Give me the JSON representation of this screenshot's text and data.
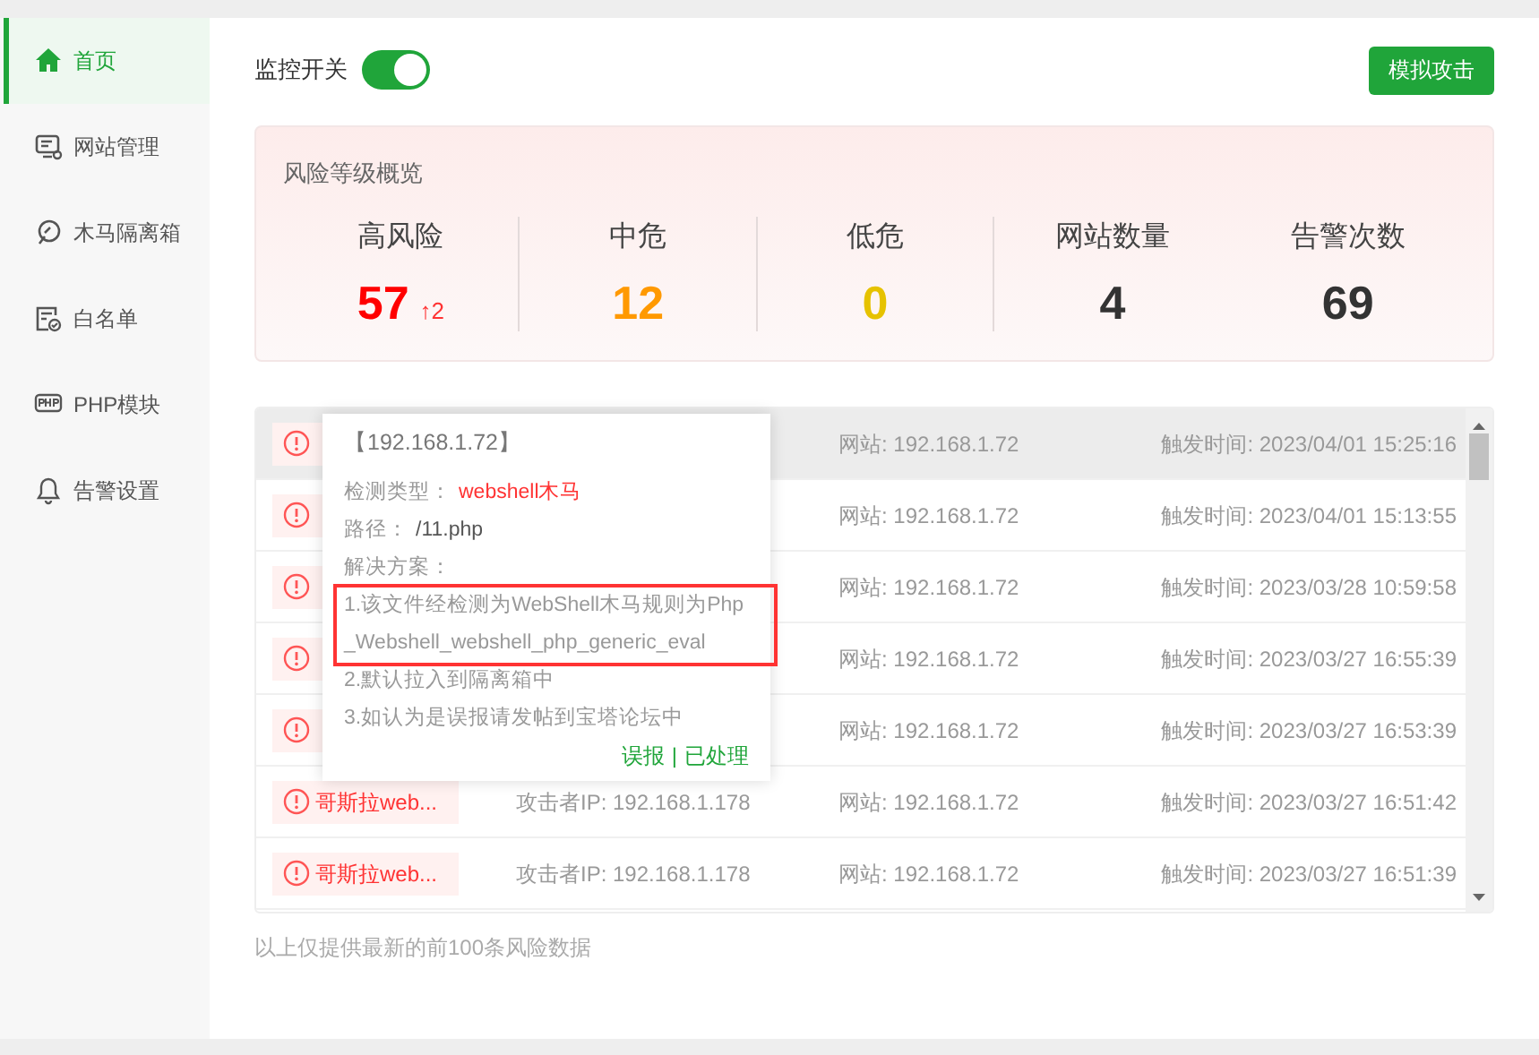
{
  "sidebar": {
    "items": [
      {
        "kind": "home",
        "label": "首页",
        "selected": true
      },
      {
        "kind": "site",
        "label": "网站管理",
        "selected": false
      },
      {
        "kind": "trojan",
        "label": "木马隔离箱",
        "selected": false
      },
      {
        "kind": "whitelist",
        "label": "白名单",
        "selected": false
      },
      {
        "kind": "php",
        "label": "PHP模块",
        "selected": false
      },
      {
        "kind": "bell",
        "label": "告警设置",
        "selected": false
      }
    ]
  },
  "monitor": {
    "label": "监控开关",
    "on": true
  },
  "simulate_button": "模拟攻击",
  "overview": {
    "title": "风险等级概览",
    "stats": [
      {
        "label": "高风险",
        "value": "57",
        "color": "#ff0000",
        "delta": "↑2"
      },
      {
        "label": "中危",
        "value": "12",
        "color": "#ff9900"
      },
      {
        "label": "低危",
        "value": "0",
        "color": "#e6c200"
      },
      {
        "label": "网站数量",
        "value": "4",
        "color": "#333333"
      },
      {
        "label": "告警次数",
        "value": "69",
        "color": "#333333"
      }
    ]
  },
  "events": [
    {
      "site": "网站: 192.168.1.72",
      "time": "触发时间: 2023/04/01 15:25:16",
      "hovered": true
    },
    {
      "site": "网站: 192.168.1.72",
      "time": "触发时间: 2023/04/01 15:13:55",
      "hovered": false
    },
    {
      "site": "网站: 192.168.1.72",
      "time": "触发时间: 2023/03/28 10:59:58",
      "hovered": false
    },
    {
      "site": "网站: 192.168.1.72",
      "time": "触发时间: 2023/03/27 16:55:39",
      "hovered": false
    },
    {
      "site": "网站: 192.168.1.72",
      "time": "触发时间: 2023/03/27 16:53:39",
      "hovered": false
    },
    {
      "tag": "哥斯拉web...",
      "attacker": "攻击者IP: 192.168.1.178",
      "site": "网站: 192.168.1.72",
      "time": "触发时间: 2023/03/27 16:51:42",
      "hovered": false
    },
    {
      "tag": "哥斯拉web...",
      "attacker": "攻击者IP: 192.168.1.178",
      "site": "网站: 192.168.1.72",
      "time": "触发时间: 2023/03/27 16:51:39",
      "hovered": false
    }
  ],
  "popup": {
    "title": "【192.168.1.72】",
    "type_label": "检测类型：",
    "type_value": "webshell木马",
    "path_label": "路径：",
    "path_value": "/11.php",
    "solution_label": "解决方案：",
    "steps": [
      {
        "text": "1.该文件经检测为WebShell木马规则为Php_Webshell_webshell_php_generic_eval",
        "highlighted": true
      },
      {
        "text": "2.默认拉入到隔离箱中",
        "highlighted": false
      },
      {
        "text": "3.如认为是误报请发帖到宝塔论坛中",
        "highlighted": false
      }
    ],
    "links": [
      "误报",
      "已处理"
    ],
    "separator": "|"
  },
  "footer": "以上仅提供最新的前100条风险数据"
}
